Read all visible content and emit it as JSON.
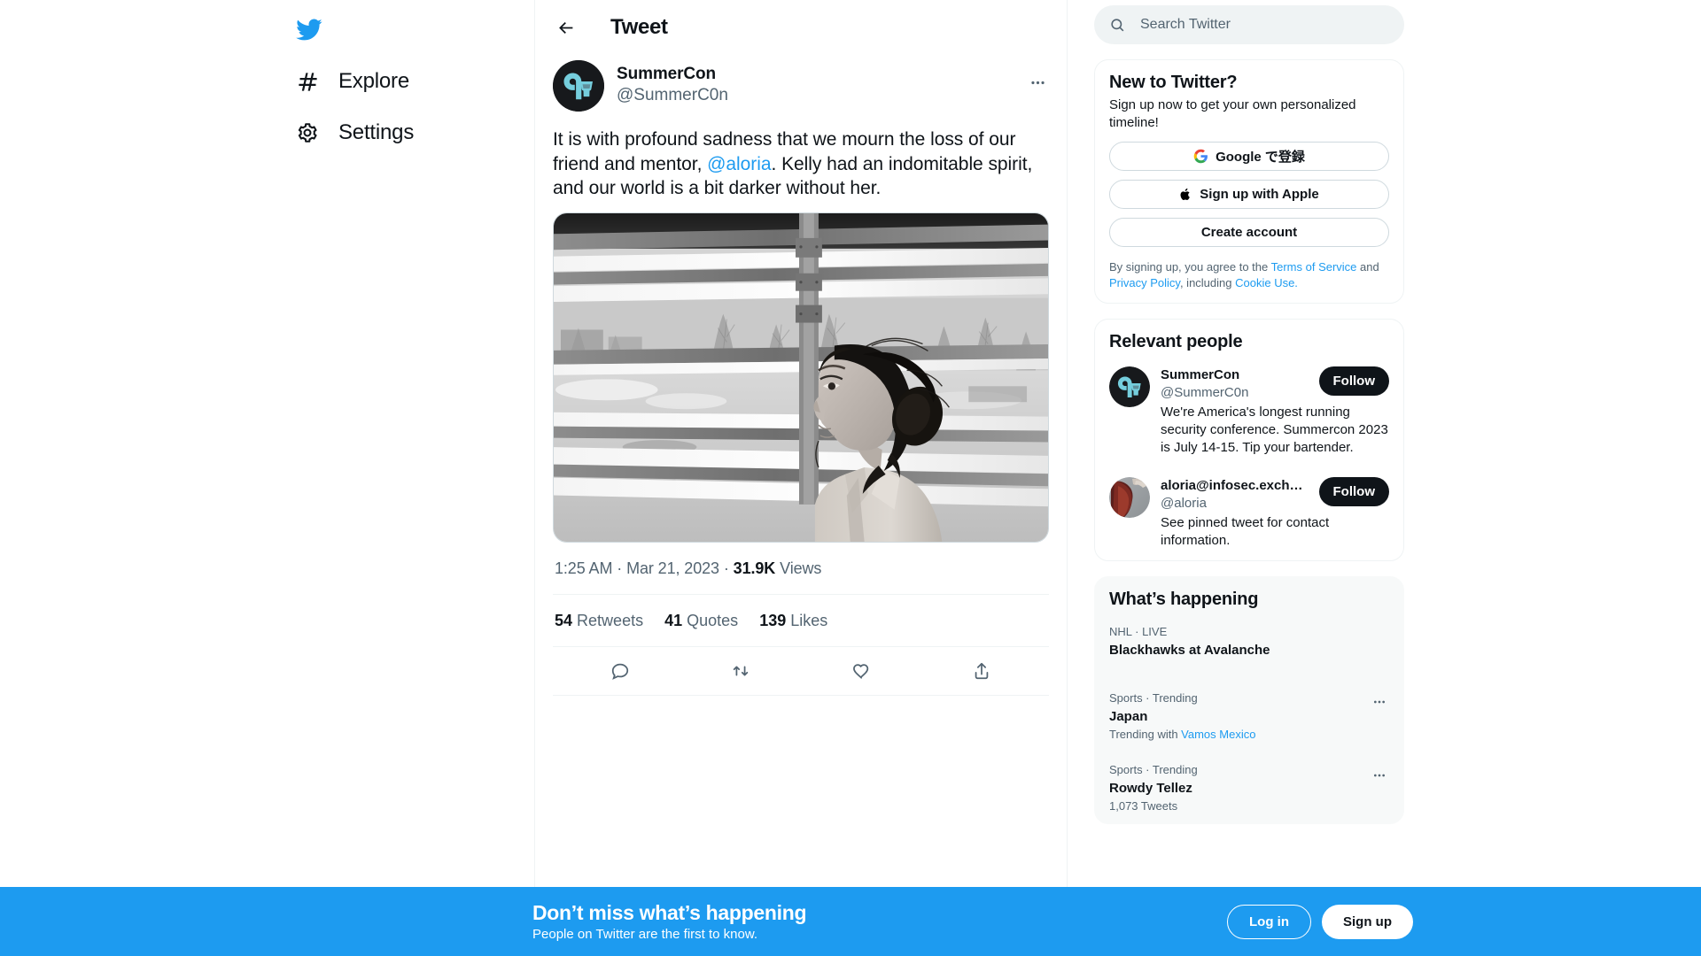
{
  "sidebar": {
    "logo": "twitter-bird",
    "items": [
      {
        "label": "Explore",
        "icon": "hashtag-icon"
      },
      {
        "label": "Settings",
        "icon": "gear-icon"
      }
    ]
  },
  "header": {
    "title": "Tweet",
    "back_icon": "arrow-left-icon"
  },
  "tweet": {
    "author_name": "SummerCon",
    "author_handle": "@SummerC0n",
    "text_part1": "It is with profound sadness that we mourn the loss of our friend and mentor, ",
    "mention": "@aloria",
    "text_part2": ". Kelly had an indomitable spirit, and our world is a bit darker without her.",
    "time": "1:25 AM",
    "date": "Mar 21, 2023",
    "views_count": "31.9K",
    "views_label": "Views",
    "dot": "·",
    "media_alt": "Black and white photo of a woman in profile in front of a fence",
    "stats": [
      {
        "count": "54",
        "label": "Retweets"
      },
      {
        "count": "41",
        "label": "Quotes"
      },
      {
        "count": "139",
        "label": "Likes"
      }
    ],
    "actions": [
      {
        "name": "reply-icon"
      },
      {
        "name": "retweet-icon"
      },
      {
        "name": "like-icon"
      },
      {
        "name": "share-icon"
      }
    ]
  },
  "search": {
    "placeholder": "Search Twitter",
    "value": "",
    "icon": "search-icon"
  },
  "signup_card": {
    "title": "New to Twitter?",
    "subtitle": "Sign up now to get your own personalized timeline!",
    "google_button": "Google で登録",
    "apple_button": "Sign up with Apple",
    "create_button": "Create account",
    "legal_prefix": "By signing up, you agree to the ",
    "terms": "Terms of Service",
    "legal_and": " and ",
    "privacy": "Privacy Policy",
    "legal_including": ", including ",
    "cookie": "Cookie Use.",
    "legal_suffix": ""
  },
  "relevant_people": {
    "title": "Relevant people",
    "people": [
      {
        "name": "SummerCon",
        "handle": "@SummerC0n",
        "bio": "We're America's longest running security conference. Summercon 2023 is July 14-15. Tip your bartender.",
        "follow_label": "Follow",
        "avatar": "summercon-logo"
      },
      {
        "name": "aloria@infosec.exch…",
        "handle": "@aloria",
        "bio": "See pinned tweet for contact information.",
        "follow_label": "Follow",
        "avatar": "aloria-photo"
      }
    ]
  },
  "whats_happening": {
    "title": "What’s happening",
    "trends": [
      {
        "category": "NHL · LIVE",
        "name": "Blackhawks at Avalanche",
        "meta": "",
        "meta_link": "",
        "has_dots": false
      },
      {
        "category": "Sports · Trending",
        "name": "Japan",
        "meta": "Trending with ",
        "meta_link": "Vamos Mexico",
        "has_dots": true
      },
      {
        "category": "Sports · Trending",
        "name": "Rowdy Tellez",
        "meta": "1,073 Tweets",
        "meta_link": "",
        "has_dots": true
      }
    ]
  },
  "banner": {
    "title": "Don’t miss what’s happening",
    "subtitle": "People on Twitter are the first to know.",
    "login_label": "Log in",
    "signup_label": "Sign up"
  },
  "colors": {
    "brand_blue": "#1d9bf0",
    "text": "#0f1419",
    "muted": "#536471",
    "border": "#eff3f4",
    "card_grey": "#f7f9f9"
  }
}
